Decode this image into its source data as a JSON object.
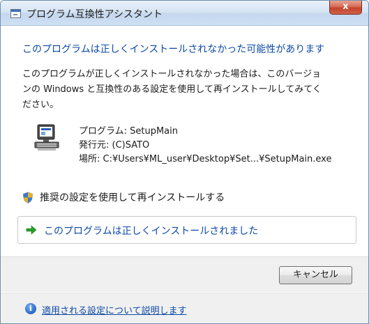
{
  "window": {
    "title": "プログラム互換性アシスタント",
    "close_label": "x"
  },
  "main": {
    "headline": "このプログラムは正しくインストールされなかった可能性があります",
    "description_lines": [
      "このプログラムが正しくインストールされなかった場合は、このバージョ",
      "ンの Windows と互換性のある設定を使用して再インストールしてみてく",
      "ださい。"
    ]
  },
  "program": {
    "name_line": "プログラム: SetupMain",
    "publisher_line": "発行元: (C)SATO",
    "location_line": "場所: C:¥Users¥ML_user¥Desktop¥Set...¥SetupMain.exe"
  },
  "options": {
    "reinstall_label": "推奨の設定を使用して再インストールする",
    "installed_ok_label": "このプログラムは正しくインストールされました"
  },
  "buttons": {
    "cancel_label": "キャンセル"
  },
  "footer": {
    "info_icon_glyph": "i",
    "link_label": "適用される設定について説明します"
  },
  "colors": {
    "link_blue": "#0d4aa6",
    "close_red": "#c4432b",
    "arrow_green": "#2a9d2a"
  }
}
